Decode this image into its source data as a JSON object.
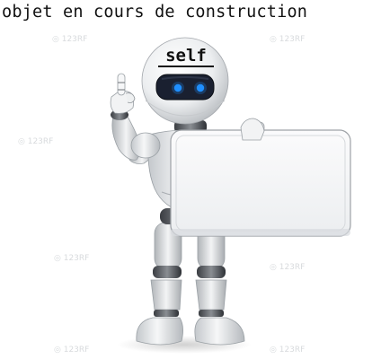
{
  "caption": "objet en cours de construction",
  "robot": {
    "head_label": "self",
    "eye_color": "#1f8fff",
    "visor_color": "#1a2030",
    "board_color": "#f4f5f6"
  }
}
